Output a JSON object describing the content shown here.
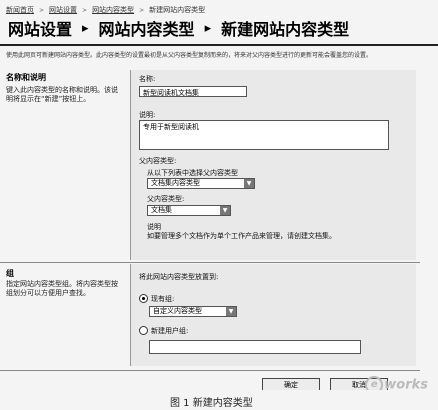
{
  "breadcrumb": {
    "items": [
      "新闻首页",
      "网站设置",
      "网站内容类型",
      "新建网站内容类型"
    ]
  },
  "title": {
    "part1": "网站设置",
    "part2": "网站内容类型",
    "part3": "新建网站内容类型"
  },
  "intro": {
    "text": "使用此网页可新建网站内容类型。此内容类型的设置最初是从父内容类型复制而来的，将来对父内容类型进行的更新可能会覆盖您的设置。"
  },
  "section_name": {
    "heading": "名称和说明",
    "desc": "键入此内容类型的名称和说明。该说明将显示在“新建”按钮上。",
    "name_label": "名称:",
    "name_value": "新型阅读机文档集",
    "desc_label": "说明:",
    "desc_value": "专用于新型阅读机",
    "parent_label": "父内容类型:",
    "parent_group_label": "从以下列表中选择父内容类型",
    "parent_group_value": "文档集内容类型",
    "parent_type_label": "父内容类型:",
    "parent_type_value": "文档集",
    "explain_label": "说明",
    "explain_text": "如要管理多个文档作为单个工作产品来管理，请创建文档集。"
  },
  "section_group": {
    "heading": "组",
    "desc": "指定网站内容类型组。将内容类型按组划分可以方便用户查找。",
    "put_label": "将此网站内容类型放置到:",
    "existing_label": "现有组:",
    "existing_value": "自定义内容类型",
    "new_label": "新建用户组:",
    "new_value": ""
  },
  "buttons": {
    "ok": "确定",
    "cancel": "取消"
  },
  "caption": "图 1 新建内容类型",
  "watermark": "works"
}
